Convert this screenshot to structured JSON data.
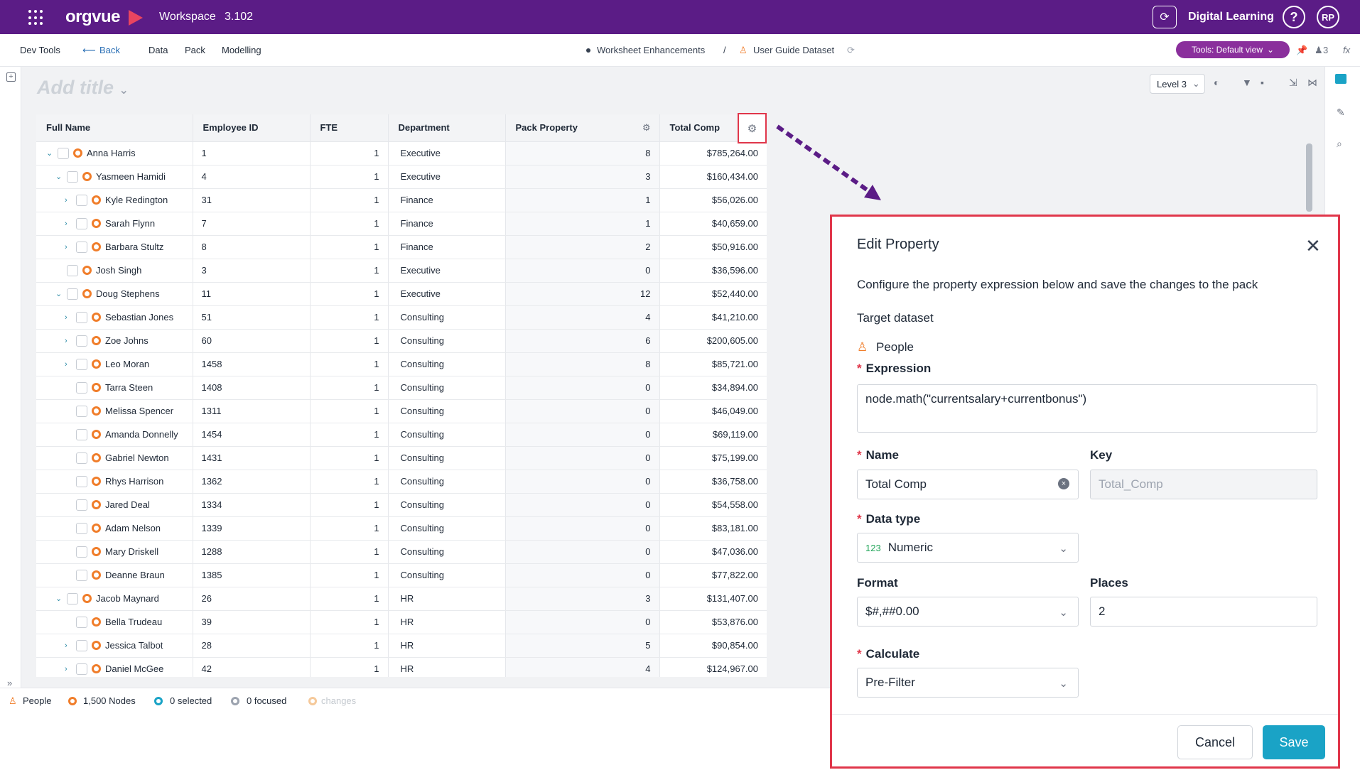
{
  "topbar": {
    "logo": "orgvue",
    "workspace_label": "Workspace",
    "version": "3.102",
    "org_name": "Digital Learning",
    "help": "?",
    "avatar_initials": "RP"
  },
  "menubar": {
    "items": [
      "Dev Tools",
      "Back",
      "Data",
      "Pack",
      "Modelling"
    ],
    "breadcrumb_worksheet": "Worksheet Enhancements",
    "breadcrumb_sep": "/",
    "breadcrumb_dataset": "User Guide Dataset",
    "tools_button": "Tools: Default view",
    "user_count": "3",
    "fx": "fx"
  },
  "worksheet": {
    "title_placeholder": "Add title",
    "level": "Level 3"
  },
  "table": {
    "columns": [
      "Full Name",
      "Employee ID",
      "FTE",
      "Department",
      "Pack Property",
      "Total Comp"
    ],
    "rows": [
      {
        "indent": 0,
        "expand": "open",
        "name": "Anna Harris",
        "id": "1",
        "fte": "1",
        "dept": "Executive",
        "pack": "8",
        "comp": "$785,264.00"
      },
      {
        "indent": 1,
        "expand": "open",
        "name": "Yasmeen Hamidi",
        "id": "4",
        "fte": "1",
        "dept": "Executive",
        "pack": "3",
        "comp": "$160,434.00"
      },
      {
        "indent": 2,
        "expand": "closed",
        "name": "Kyle Redington",
        "id": "31",
        "fte": "1",
        "dept": "Finance",
        "pack": "1",
        "comp": "$56,026.00"
      },
      {
        "indent": 2,
        "expand": "closed",
        "name": "Sarah Flynn",
        "id": "7",
        "fte": "1",
        "dept": "Finance",
        "pack": "1",
        "comp": "$40,659.00"
      },
      {
        "indent": 2,
        "expand": "closed",
        "name": "Barbara Stultz",
        "id": "8",
        "fte": "1",
        "dept": "Finance",
        "pack": "2",
        "comp": "$50,916.00"
      },
      {
        "indent": 1,
        "expand": "none",
        "name": "Josh Singh",
        "id": "3",
        "fte": "1",
        "dept": "Executive",
        "pack": "0",
        "comp": "$36,596.00"
      },
      {
        "indent": 1,
        "expand": "open",
        "name": "Doug Stephens",
        "id": "11",
        "fte": "1",
        "dept": "Executive",
        "pack": "12",
        "comp": "$52,440.00"
      },
      {
        "indent": 2,
        "expand": "closed",
        "name": "Sebastian Jones",
        "id": "51",
        "fte": "1",
        "dept": "Consulting",
        "pack": "4",
        "comp": "$41,210.00"
      },
      {
        "indent": 2,
        "expand": "closed",
        "name": "Zoe Johns",
        "id": "60",
        "fte": "1",
        "dept": "Consulting",
        "pack": "6",
        "comp": "$200,605.00"
      },
      {
        "indent": 2,
        "expand": "closed",
        "name": "Leo Moran",
        "id": "1458",
        "fte": "1",
        "dept": "Consulting",
        "pack": "8",
        "comp": "$85,721.00"
      },
      {
        "indent": 2,
        "expand": "none",
        "name": "Tarra Steen",
        "id": "1408",
        "fte": "1",
        "dept": "Consulting",
        "pack": "0",
        "comp": "$34,894.00"
      },
      {
        "indent": 2,
        "expand": "none",
        "name": "Melissa Spencer",
        "id": "1311",
        "fte": "1",
        "dept": "Consulting",
        "pack": "0",
        "comp": "$46,049.00"
      },
      {
        "indent": 2,
        "expand": "none",
        "name": "Amanda Donnelly",
        "id": "1454",
        "fte": "1",
        "dept": "Consulting",
        "pack": "0",
        "comp": "$69,119.00"
      },
      {
        "indent": 2,
        "expand": "none",
        "name": "Gabriel Newton",
        "id": "1431",
        "fte": "1",
        "dept": "Consulting",
        "pack": "0",
        "comp": "$75,199.00"
      },
      {
        "indent": 2,
        "expand": "none",
        "name": "Rhys Harrison",
        "id": "1362",
        "fte": "1",
        "dept": "Consulting",
        "pack": "0",
        "comp": "$36,758.00"
      },
      {
        "indent": 2,
        "expand": "none",
        "name": "Jared Deal",
        "id": "1334",
        "fte": "1",
        "dept": "Consulting",
        "pack": "0",
        "comp": "$54,558.00"
      },
      {
        "indent": 2,
        "expand": "none",
        "name": "Adam Nelson",
        "id": "1339",
        "fte": "1",
        "dept": "Consulting",
        "pack": "0",
        "comp": "$83,181.00"
      },
      {
        "indent": 2,
        "expand": "none",
        "name": "Mary Driskell",
        "id": "1288",
        "fte": "1",
        "dept": "Consulting",
        "pack": "0",
        "comp": "$47,036.00"
      },
      {
        "indent": 2,
        "expand": "none",
        "name": "Deanne Braun",
        "id": "1385",
        "fte": "1",
        "dept": "Consulting",
        "pack": "0",
        "comp": "$77,822.00"
      },
      {
        "indent": 1,
        "expand": "open",
        "name": "Jacob Maynard",
        "id": "26",
        "fte": "1",
        "dept": "HR",
        "pack": "3",
        "comp": "$131,407.00"
      },
      {
        "indent": 2,
        "expand": "none",
        "name": "Bella Trudeau",
        "id": "39",
        "fte": "1",
        "dept": "HR",
        "pack": "0",
        "comp": "$53,876.00"
      },
      {
        "indent": 2,
        "expand": "closed",
        "name": "Jessica Talbot",
        "id": "28",
        "fte": "1",
        "dept": "HR",
        "pack": "5",
        "comp": "$90,854.00"
      },
      {
        "indent": 2,
        "expand": "closed",
        "name": "Daniel McGee",
        "id": "42",
        "fte": "1",
        "dept": "HR",
        "pack": "4",
        "comp": "$124,967.00"
      }
    ]
  },
  "statusbar": {
    "dataset": "People",
    "nodes": "1,500 Nodes",
    "selected": "0 selected",
    "focused": "0 focused",
    "changes": "changes"
  },
  "dialog": {
    "title": "Edit Property",
    "description": "Configure the property expression below and save the changes to the pack",
    "target_label": "Target dataset",
    "target_value": "People",
    "expression_label": "Expression",
    "expression_value": "node.math(\"currentsalary+currentbonus\")",
    "name_label": "Name",
    "name_value": "Total Comp",
    "key_label": "Key",
    "key_value": "Total_Comp",
    "datatype_label": "Data type",
    "datatype_badge": "123",
    "datatype_value": "Numeric",
    "format_label": "Format",
    "format_value": "$#,##0.00",
    "places_label": "Places",
    "places_value": "2",
    "calculate_label": "Calculate",
    "calculate_value": "Pre-Filter",
    "cancel": "Cancel",
    "save": "Save"
  },
  "colors": {
    "brand": "#5b1c86",
    "accent": "#8a2f9c",
    "highlight": "#e0364a",
    "save": "#1aa3c6",
    "node": "#f07d2a"
  }
}
